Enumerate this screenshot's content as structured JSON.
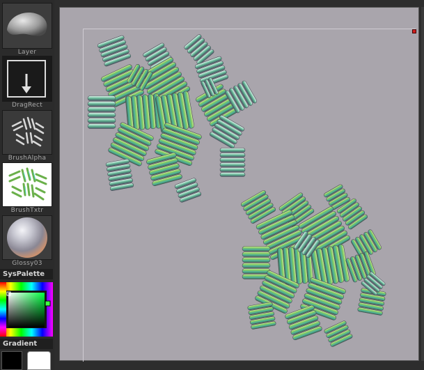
{
  "shelf": {
    "tiles": [
      {
        "label": "Layer"
      },
      {
        "label": "DragRect"
      },
      {
        "label": "BrushAlpha"
      },
      {
        "label": "BrushTxtr"
      },
      {
        "label": "Glossy03"
      }
    ],
    "syspalette_label": "SysPalette",
    "gradient_label": "Gradient",
    "colors": {
      "main": "#000000",
      "secondary": "#ffffff"
    }
  },
  "canvas": {
    "background": "#a9a5ac",
    "strokes": [
      {
        "name": "upper-left-stroke-cluster"
      },
      {
        "name": "lower-right-stroke-cluster"
      }
    ]
  }
}
